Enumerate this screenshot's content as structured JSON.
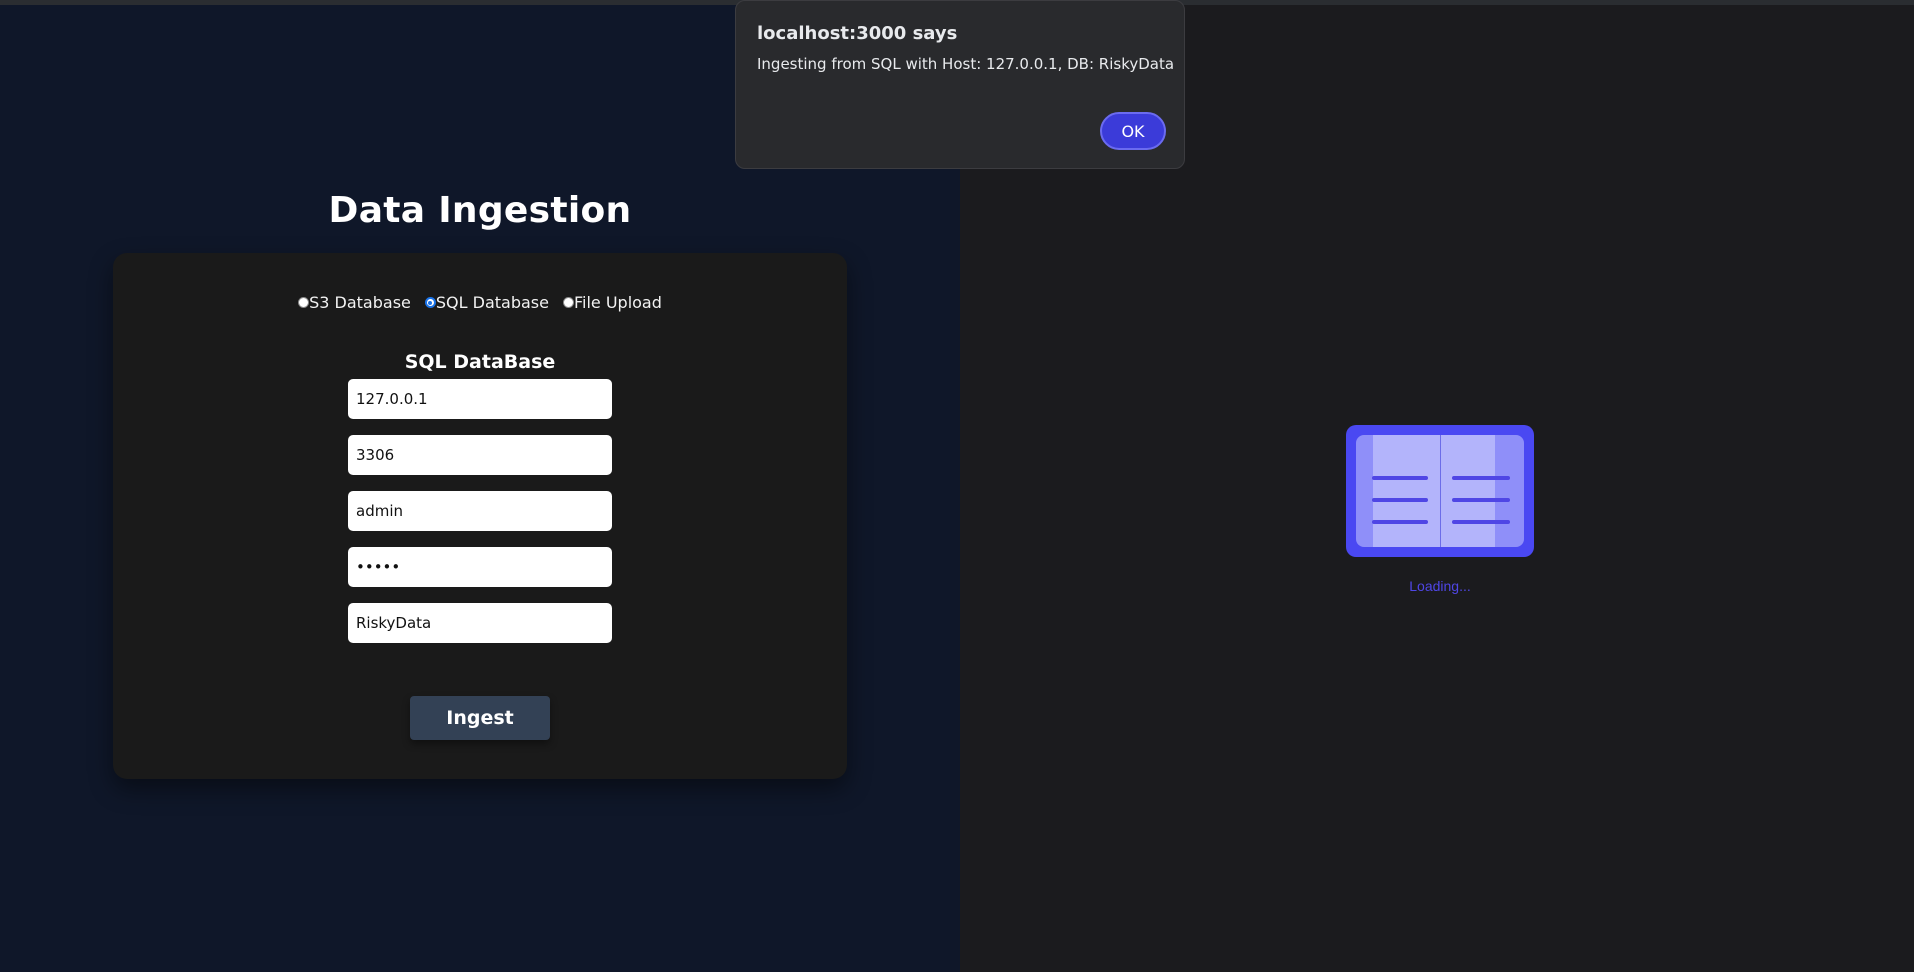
{
  "page": {
    "title": "Data Ingestion"
  },
  "source_options": [
    {
      "label": "S3 Database",
      "checked": false
    },
    {
      "label": "SQL Database",
      "checked": true
    },
    {
      "label": "File Upload",
      "checked": false
    }
  ],
  "sql_form": {
    "heading": "SQL DataBase",
    "host": "127.0.0.1",
    "port": "3306",
    "user": "admin",
    "password_mask": "•••••",
    "database": "RiskyData",
    "submit_label": "Ingest"
  },
  "loader": {
    "text": "Loading..."
  },
  "alert": {
    "title": "localhost:3000 says",
    "message": "Ingesting from SQL with Host: 127.0.0.1, DB: RiskyData",
    "ok_label": "OK"
  },
  "colors": {
    "left_background": "#0f1729",
    "right_background": "#1b1b1e",
    "card_background": "#1a1a1a",
    "button": "#334155",
    "accent": "#4f46e5",
    "radio_selected": "#1a73e8"
  }
}
